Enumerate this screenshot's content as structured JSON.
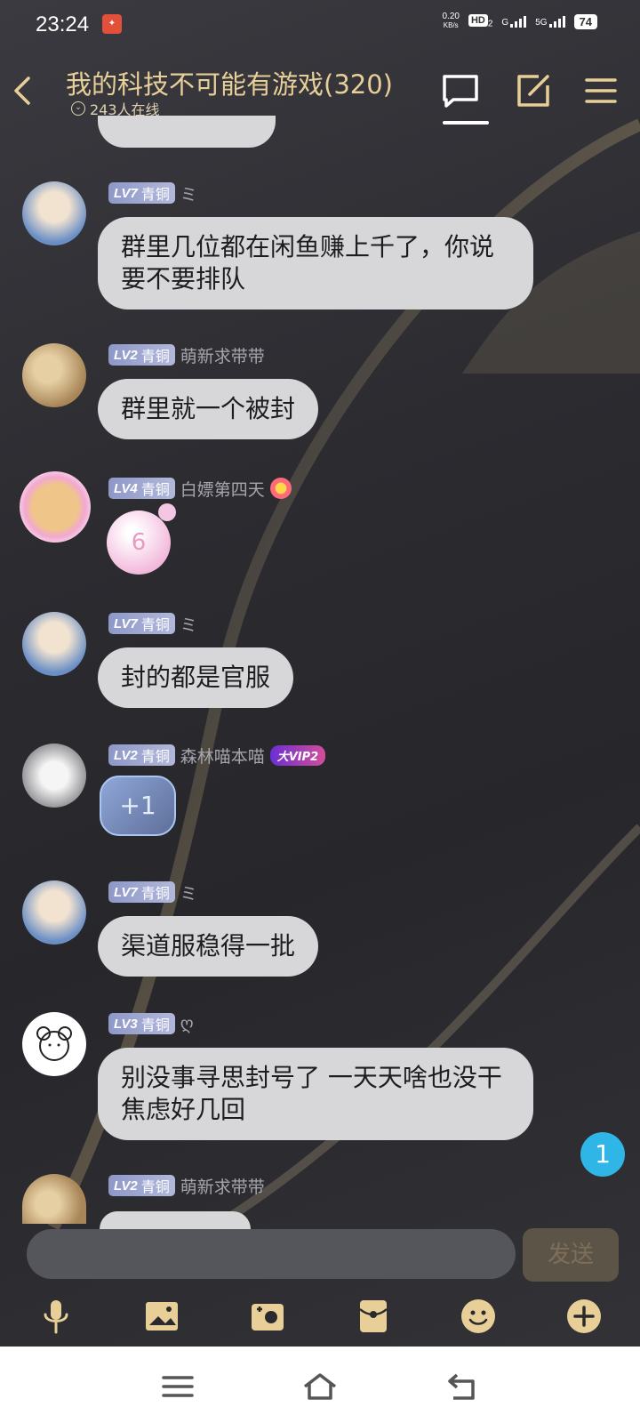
{
  "status": {
    "time": "23:24",
    "net_speed_value": "0.20",
    "net_speed_unit": "KB/s",
    "hd": "HD",
    "hd_sub": "2",
    "g_label": "G",
    "five_g": "5G",
    "battery": "74"
  },
  "header": {
    "title": "我的科技不可能有游戏(320)",
    "online": "243人在线"
  },
  "messages": [
    {
      "level": "LV7",
      "rank": "青铜",
      "nick": "ミ",
      "text": "群里几位都在闲鱼赚上千了，你说要不要排队"
    },
    {
      "level": "LV2",
      "rank": "青铜",
      "nick": "萌新求带带",
      "text": "群里就一个被封"
    },
    {
      "level": "LV4",
      "rank": "青铜",
      "nick": "白嫖第四天",
      "sticker": "6"
    },
    {
      "level": "LV7",
      "rank": "青铜",
      "nick": "ミ",
      "text": "封的都是官服"
    },
    {
      "level": "LV2",
      "rank": "青铜",
      "nick": "森林喵本喵",
      "vip": "大VIP2",
      "sticker": "+1"
    },
    {
      "level": "LV7",
      "rank": "青铜",
      "nick": "ミ",
      "text": "渠道服稳得一批"
    },
    {
      "level": "LV3",
      "rank": "青铜",
      "nick": "ღ",
      "text": "别没事寻思封号了 一天天啥也没干焦虑好几回"
    },
    {
      "level": "LV2",
      "rank": "青铜",
      "nick": "萌新求带带"
    }
  ],
  "unread_count": "1",
  "input": {
    "placeholder": "",
    "send_label": "发送"
  },
  "colors": {
    "accent": "#e8cf98",
    "bubble": "#d7d7d9",
    "badge": "#2fb6e6"
  }
}
